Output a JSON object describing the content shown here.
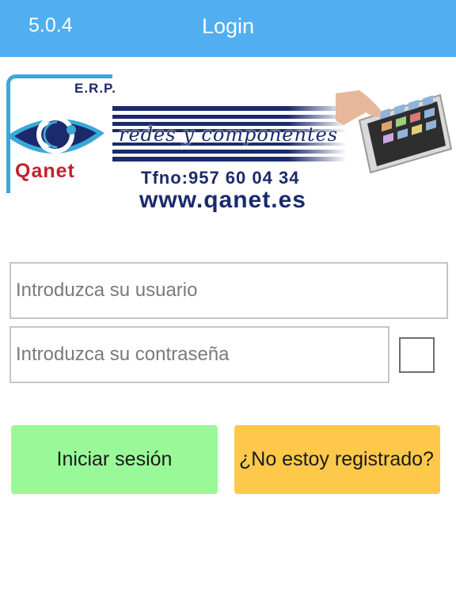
{
  "header": {
    "version": "5.0.4",
    "title": "Login"
  },
  "banner": {
    "erp_label": "E.R.P.",
    "brand": "Qanet",
    "tagline": "redes y componentes",
    "phone": "Tfno:957 60 04 34",
    "website": "www.qanet.es"
  },
  "form": {
    "user_placeholder": "Introduzca su usuario",
    "password_placeholder": "Introduzca su contraseña"
  },
  "buttons": {
    "login": "Iniciar sesión",
    "register": "¿No estoy registrado?"
  },
  "colors": {
    "header": "#51aef0",
    "login_button": "#99f998",
    "register_button": "#fec84b",
    "brand_blue": "#1b2a6b",
    "brand_red": "#c4202f"
  }
}
